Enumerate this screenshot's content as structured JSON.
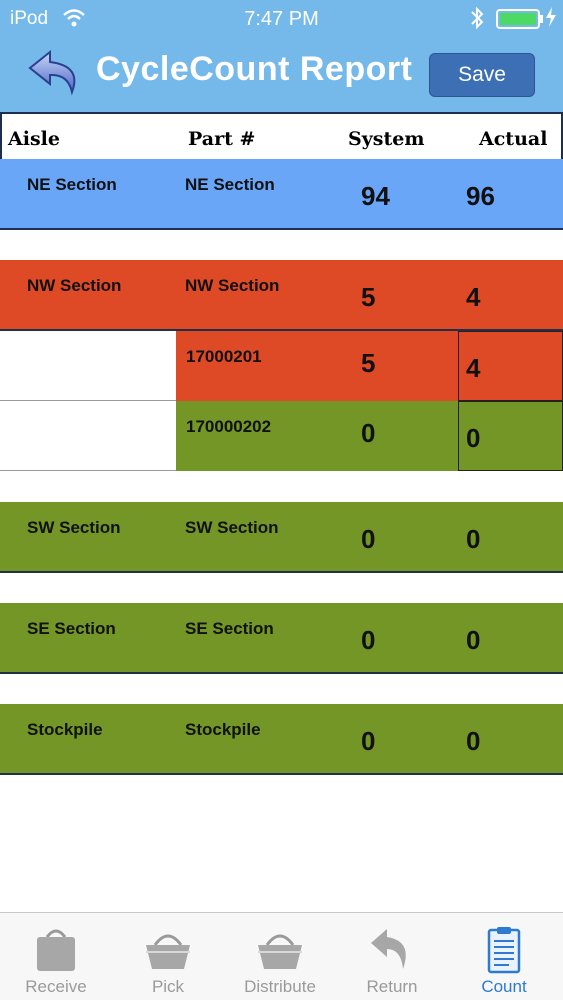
{
  "status": {
    "carrier": "iPod",
    "time": "7:47 PM"
  },
  "header": {
    "title": "CycleCount Report",
    "save_label": "Save"
  },
  "columns": {
    "aisle": "Aisle",
    "part": "Part #",
    "system": "System",
    "actual": "Actual"
  },
  "rows": [
    {
      "aisle": "NE Section",
      "part": "NE Section",
      "system": "94",
      "actual": "96",
      "color": "#6aa6f8"
    },
    {
      "aisle": "NW Section",
      "part": "NW Section",
      "system": "5",
      "actual": "4",
      "color": "#de4a26"
    },
    {
      "aisle": "SW Section",
      "part": "SW Section",
      "system": "0",
      "actual": "0",
      "color": "#739627"
    },
    {
      "aisle": "SE Section",
      "part": "SE Section",
      "system": "0",
      "actual": "0",
      "color": "#739627"
    },
    {
      "aisle": "Stockpile",
      "part": "Stockpile",
      "system": "0",
      "actual": "0",
      "color": "#739627"
    }
  ],
  "subrows": [
    {
      "part": "17000201",
      "system": "5",
      "actual": "4",
      "color": "#de4a26"
    },
    {
      "part": "170000202",
      "system": "0",
      "actual": "0",
      "color": "#739627"
    }
  ],
  "tabs": [
    {
      "label": "Receive",
      "icon": "bag-icon"
    },
    {
      "label": "Pick",
      "icon": "basket-icon"
    },
    {
      "label": "Distribute",
      "icon": "basket-icon"
    },
    {
      "label": "Return",
      "icon": "return-arrow-icon"
    },
    {
      "label": "Count",
      "icon": "clipboard-icon",
      "active": true
    }
  ],
  "colors": {
    "header": "#74b9e9",
    "save": "#3d6fb5",
    "active_tab": "#2e7ad1"
  }
}
